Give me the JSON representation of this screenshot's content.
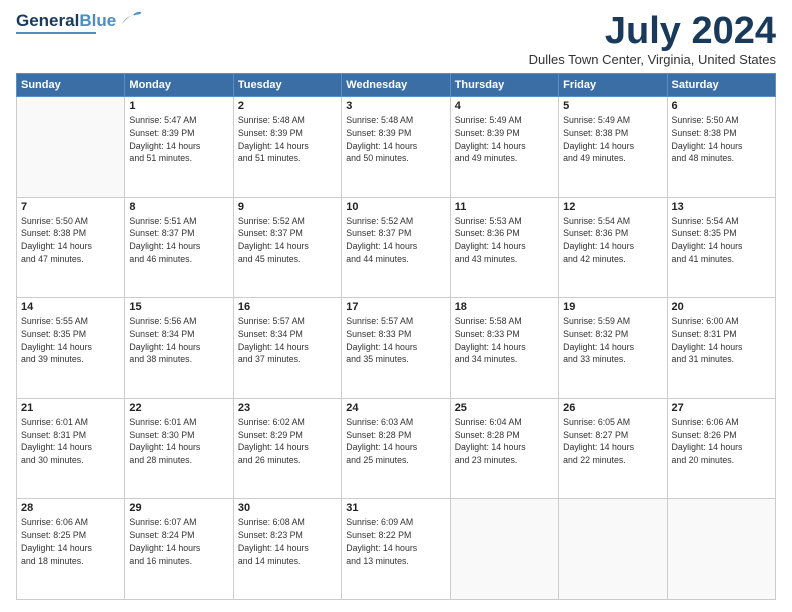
{
  "header": {
    "logo_general": "General",
    "logo_blue": "Blue",
    "month_title": "July 2024",
    "location": "Dulles Town Center, Virginia, United States"
  },
  "weekdays": [
    "Sunday",
    "Monday",
    "Tuesday",
    "Wednesday",
    "Thursday",
    "Friday",
    "Saturday"
  ],
  "weeks": [
    [
      {
        "day": "",
        "content": ""
      },
      {
        "day": "1",
        "content": "Sunrise: 5:47 AM\nSunset: 8:39 PM\nDaylight: 14 hours\nand 51 minutes."
      },
      {
        "day": "2",
        "content": "Sunrise: 5:48 AM\nSunset: 8:39 PM\nDaylight: 14 hours\nand 51 minutes."
      },
      {
        "day": "3",
        "content": "Sunrise: 5:48 AM\nSunset: 8:39 PM\nDaylight: 14 hours\nand 50 minutes."
      },
      {
        "day": "4",
        "content": "Sunrise: 5:49 AM\nSunset: 8:39 PM\nDaylight: 14 hours\nand 49 minutes."
      },
      {
        "day": "5",
        "content": "Sunrise: 5:49 AM\nSunset: 8:38 PM\nDaylight: 14 hours\nand 49 minutes."
      },
      {
        "day": "6",
        "content": "Sunrise: 5:50 AM\nSunset: 8:38 PM\nDaylight: 14 hours\nand 48 minutes."
      }
    ],
    [
      {
        "day": "7",
        "content": "Sunrise: 5:50 AM\nSunset: 8:38 PM\nDaylight: 14 hours\nand 47 minutes."
      },
      {
        "day": "8",
        "content": "Sunrise: 5:51 AM\nSunset: 8:37 PM\nDaylight: 14 hours\nand 46 minutes."
      },
      {
        "day": "9",
        "content": "Sunrise: 5:52 AM\nSunset: 8:37 PM\nDaylight: 14 hours\nand 45 minutes."
      },
      {
        "day": "10",
        "content": "Sunrise: 5:52 AM\nSunset: 8:37 PM\nDaylight: 14 hours\nand 44 minutes."
      },
      {
        "day": "11",
        "content": "Sunrise: 5:53 AM\nSunset: 8:36 PM\nDaylight: 14 hours\nand 43 minutes."
      },
      {
        "day": "12",
        "content": "Sunrise: 5:54 AM\nSunset: 8:36 PM\nDaylight: 14 hours\nand 42 minutes."
      },
      {
        "day": "13",
        "content": "Sunrise: 5:54 AM\nSunset: 8:35 PM\nDaylight: 14 hours\nand 41 minutes."
      }
    ],
    [
      {
        "day": "14",
        "content": "Sunrise: 5:55 AM\nSunset: 8:35 PM\nDaylight: 14 hours\nand 39 minutes."
      },
      {
        "day": "15",
        "content": "Sunrise: 5:56 AM\nSunset: 8:34 PM\nDaylight: 14 hours\nand 38 minutes."
      },
      {
        "day": "16",
        "content": "Sunrise: 5:57 AM\nSunset: 8:34 PM\nDaylight: 14 hours\nand 37 minutes."
      },
      {
        "day": "17",
        "content": "Sunrise: 5:57 AM\nSunset: 8:33 PM\nDaylight: 14 hours\nand 35 minutes."
      },
      {
        "day": "18",
        "content": "Sunrise: 5:58 AM\nSunset: 8:33 PM\nDaylight: 14 hours\nand 34 minutes."
      },
      {
        "day": "19",
        "content": "Sunrise: 5:59 AM\nSunset: 8:32 PM\nDaylight: 14 hours\nand 33 minutes."
      },
      {
        "day": "20",
        "content": "Sunrise: 6:00 AM\nSunset: 8:31 PM\nDaylight: 14 hours\nand 31 minutes."
      }
    ],
    [
      {
        "day": "21",
        "content": "Sunrise: 6:01 AM\nSunset: 8:31 PM\nDaylight: 14 hours\nand 30 minutes."
      },
      {
        "day": "22",
        "content": "Sunrise: 6:01 AM\nSunset: 8:30 PM\nDaylight: 14 hours\nand 28 minutes."
      },
      {
        "day": "23",
        "content": "Sunrise: 6:02 AM\nSunset: 8:29 PM\nDaylight: 14 hours\nand 26 minutes."
      },
      {
        "day": "24",
        "content": "Sunrise: 6:03 AM\nSunset: 8:28 PM\nDaylight: 14 hours\nand 25 minutes."
      },
      {
        "day": "25",
        "content": "Sunrise: 6:04 AM\nSunset: 8:28 PM\nDaylight: 14 hours\nand 23 minutes."
      },
      {
        "day": "26",
        "content": "Sunrise: 6:05 AM\nSunset: 8:27 PM\nDaylight: 14 hours\nand 22 minutes."
      },
      {
        "day": "27",
        "content": "Sunrise: 6:06 AM\nSunset: 8:26 PM\nDaylight: 14 hours\nand 20 minutes."
      }
    ],
    [
      {
        "day": "28",
        "content": "Sunrise: 6:06 AM\nSunset: 8:25 PM\nDaylight: 14 hours\nand 18 minutes."
      },
      {
        "day": "29",
        "content": "Sunrise: 6:07 AM\nSunset: 8:24 PM\nDaylight: 14 hours\nand 16 minutes."
      },
      {
        "day": "30",
        "content": "Sunrise: 6:08 AM\nSunset: 8:23 PM\nDaylight: 14 hours\nand 14 minutes."
      },
      {
        "day": "31",
        "content": "Sunrise: 6:09 AM\nSunset: 8:22 PM\nDaylight: 14 hours\nand 13 minutes."
      },
      {
        "day": "",
        "content": ""
      },
      {
        "day": "",
        "content": ""
      },
      {
        "day": "",
        "content": ""
      }
    ]
  ]
}
